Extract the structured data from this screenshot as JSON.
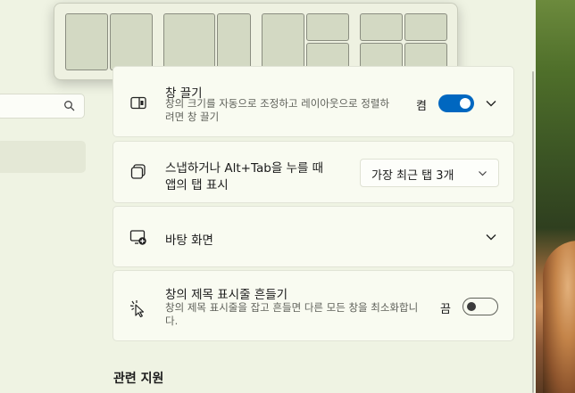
{
  "flyout": {
    "layouts": [
      "half-half",
      "two-thirds-one-third",
      "left-half-right-stacked",
      "quad-grid"
    ]
  },
  "cards": {
    "drag_window": {
      "title": "창 끌기",
      "description": "창의 크기를 자동으로 조정하고 레이아웃으로 정렬하려면 창 끌기",
      "state_label": "켬",
      "toggle_on": true,
      "icon": "snap-window-icon"
    },
    "snap_alt_tab": {
      "title_line1": "스냅하거나 Alt+Tab을 누를 때",
      "title_line2": "앱의 탭 표시",
      "dropdown_value": "가장 최근 탭 3개",
      "icon": "app-tabs-icon"
    },
    "desktop": {
      "title": "바탕 화면",
      "icon": "desktop-add-icon"
    },
    "title_bar_shake": {
      "title": "창의 제목 표시줄 흔들기",
      "description": "창의 제목 표시줄을 잡고 흔들면 다른 모든 창을 최소화합니다.",
      "state_label": "끔",
      "toggle_on": false,
      "icon": "shake-cursor-icon"
    }
  },
  "related_support": {
    "heading": "관련 지원"
  },
  "colors": {
    "accent": "#0067c0",
    "background": "#eff3e3",
    "card": "#f9fbf1"
  }
}
